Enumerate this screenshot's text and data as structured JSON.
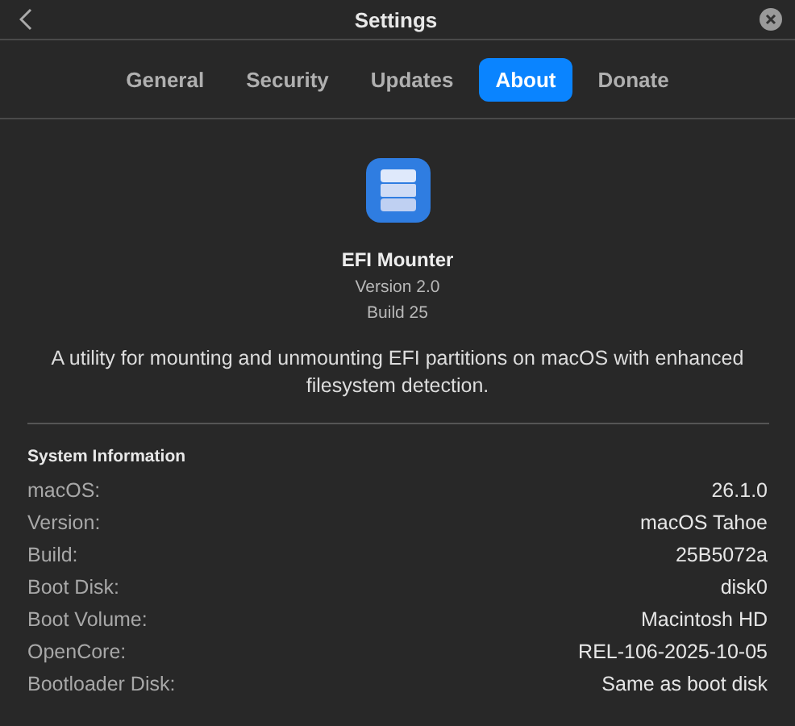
{
  "window": {
    "title": "Settings"
  },
  "tabs": [
    {
      "label": "General",
      "selected": false
    },
    {
      "label": "Security",
      "selected": false
    },
    {
      "label": "Updates",
      "selected": false
    },
    {
      "label": "About",
      "selected": true
    },
    {
      "label": "Donate",
      "selected": false
    }
  ],
  "app": {
    "name": "EFI Mounter",
    "version": "Version 2.0",
    "build": "Build 25",
    "description": "A utility for mounting and unmounting EFI partitions on macOS with enhanced filesystem detection."
  },
  "system_information": {
    "heading": "System Information",
    "rows": [
      {
        "label": "macOS:",
        "value": "26.1.0"
      },
      {
        "label": "Version:",
        "value": "macOS Tahoe"
      },
      {
        "label": "Build:",
        "value": "25B5072a"
      },
      {
        "label": "Boot Disk:",
        "value": "disk0"
      },
      {
        "label": "Boot Volume:",
        "value": "Macintosh HD"
      },
      {
        "label": "OpenCore:",
        "value": "REL-106-2025-10-05"
      },
      {
        "label": "Bootloader Disk:",
        "value": "Same as boot disk"
      }
    ]
  }
}
